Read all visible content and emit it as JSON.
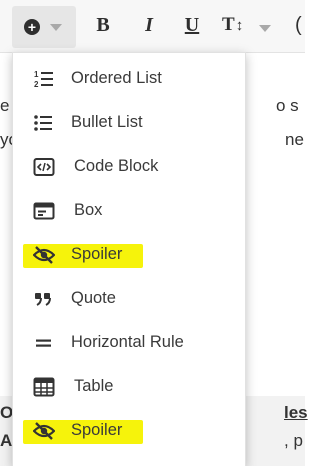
{
  "toolbar": {
    "insert_icon": "plus-circle-icon",
    "bold_label": "B",
    "italic_label": "I",
    "underline_label": "U",
    "text_size_label": "T",
    "text_size_arrows": "↕",
    "more_label": "("
  },
  "background_text": {
    "line1_left": "e",
    "line1_right": "o s",
    "line2_left": "yo",
    "line2_right": "ne",
    "bottom_left1": "Or",
    "bottom_left2": "Ac",
    "bottom_right1": "les",
    "bottom_right2": ", p"
  },
  "menu": {
    "items": [
      {
        "label": "Ordered List",
        "icon": "ordered-list-icon"
      },
      {
        "label": "Bullet List",
        "icon": "bullet-list-icon"
      },
      {
        "label": "Code Block",
        "icon": "code-block-icon"
      },
      {
        "label": "Box",
        "icon": "box-icon"
      },
      {
        "label": "Spoiler",
        "icon": "eye-slash-icon",
        "highlighted": true
      },
      {
        "label": "Quote",
        "icon": "quote-icon"
      },
      {
        "label": "Horizontal Rule",
        "icon": "horizontal-rule-icon"
      },
      {
        "label": "Table",
        "icon": "table-icon"
      },
      {
        "label": "Spoiler",
        "icon": "eye-slash-icon",
        "highlighted": true
      }
    ]
  },
  "colors": {
    "highlight": "#f6f30b",
    "text": "#3a3a3a",
    "toolbar_bg": "#f7f7f7"
  }
}
